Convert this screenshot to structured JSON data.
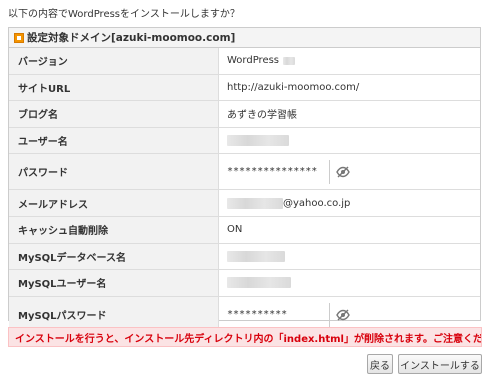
{
  "question": "以下の内容でWordPressをインストールしますか？",
  "panel": {
    "title": "設定対象ドメイン[azuki-moomoo.com]"
  },
  "fields": {
    "version": {
      "label": "バージョン",
      "value": "WordPress"
    },
    "site_url": {
      "label": "サイトURL",
      "value": "http://azuki-moomoo.com/"
    },
    "blog_name": {
      "label": "ブログ名",
      "value": "あずきの学習帳"
    },
    "username": {
      "label": "ユーザー名"
    },
    "password": {
      "label": "パスワード",
      "value": "***************"
    },
    "email": {
      "label": "メールアドレス",
      "value": "@yahoo.co.jp"
    },
    "cache_delete": {
      "label": "キャッシュ自動削除",
      "value": "ON"
    },
    "mysql_db": {
      "label": "MySQLデータベース名"
    },
    "mysql_user": {
      "label": "MySQLユーザー名"
    },
    "mysql_password": {
      "label": "MySQLパスワード",
      "value": "**********"
    }
  },
  "warning": "インストールを行うと、インストール先ディレクトリ内の「index.html」が削除されます。ご注意ください。",
  "buttons": {
    "back": "戻る",
    "install": "インストールする"
  },
  "colors": {
    "accent_orange": "#f49400",
    "warning_bg": "#fbe3e4",
    "warning_text": "#d8000c"
  },
  "icons": {
    "eye_toggle": "eye-slash-icon",
    "header_marker": "orange-square-icon"
  }
}
